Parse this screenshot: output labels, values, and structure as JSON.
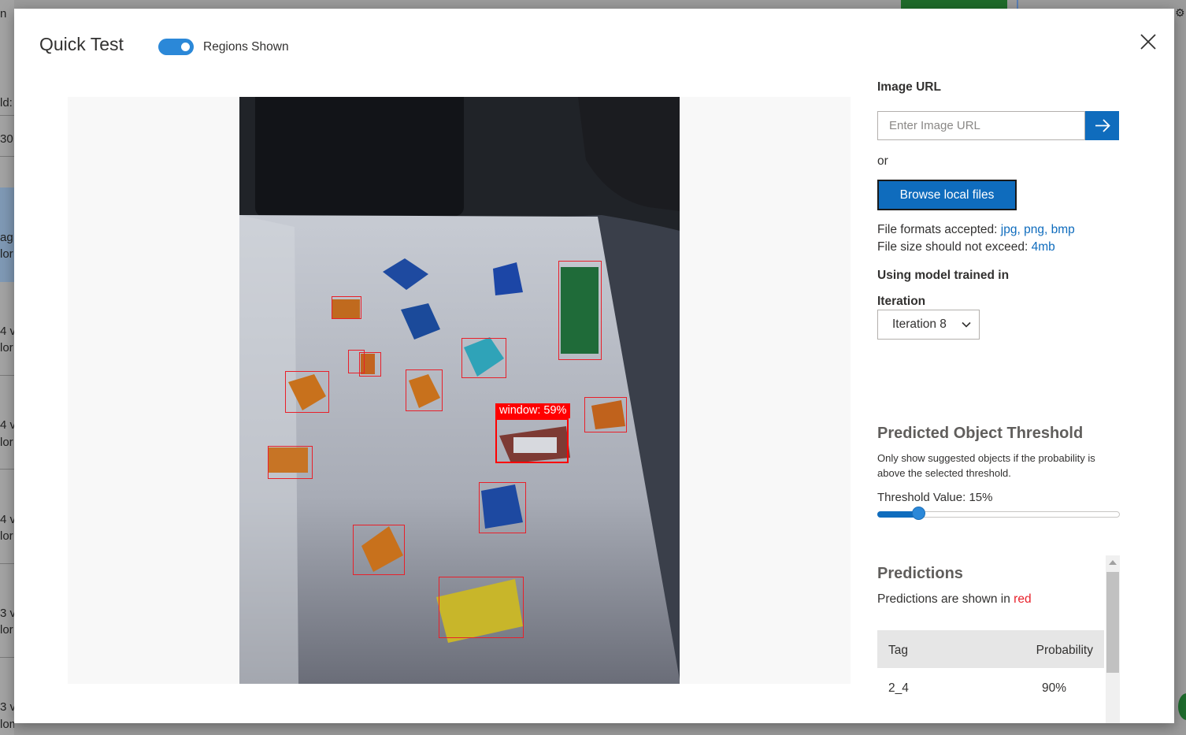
{
  "background": {
    "left_texts": [
      "n",
      "ld:",
      "30",
      "ag",
      "lor",
      "4 v",
      "lor",
      "4 v",
      "lor",
      "4 v",
      "lor",
      "3 v",
      "lor",
      "3 v",
      "lomain"
    ]
  },
  "modal": {
    "title": "Quick Test",
    "toggle": {
      "label": "Regions Shown",
      "on": true
    }
  },
  "image": {
    "alt": "Photo of LEGO bricks on a white board with detected regions",
    "regions_count": 16,
    "main_label": "window: 59%"
  },
  "panel": {
    "image_url_label": "Image URL",
    "image_url_placeholder": "Enter Image URL",
    "image_url_value": "",
    "or_text": "or",
    "browse_label": "Browse local files",
    "formats_prefix": "File formats accepted: ",
    "formats": "jpg, png, bmp",
    "size_prefix": "File size should not exceed: ",
    "size": "4mb",
    "model_label": "Using model trained in",
    "iteration_label": "Iteration",
    "iteration_value": "Iteration 8",
    "threshold_title": "Predicted Object Threshold",
    "threshold_desc": "Only show suggested objects if the probability is above the selected threshold.",
    "threshold_label": "Threshold Value: 15%",
    "threshold_value": 0.15,
    "predictions_title": "Predictions",
    "predictions_sub_prefix": "Predictions are shown in ",
    "predictions_sub_color": "red",
    "table": {
      "headers": [
        "Tag",
        "Probability"
      ],
      "rows": [
        {
          "tag": "2_4",
          "probability": "90%"
        }
      ]
    }
  },
  "colors": {
    "accent": "#0f6cbd",
    "toggle": "#2b88d8",
    "region": "#ff0000"
  }
}
